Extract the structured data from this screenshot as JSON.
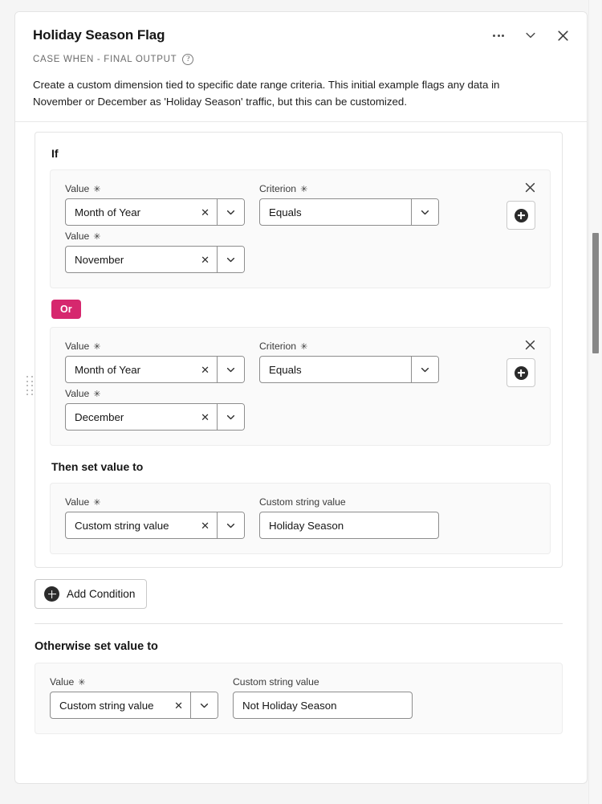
{
  "header": {
    "title": "Holiday Season Flag",
    "subtitle": "CASE WHEN - FINAL OUTPUT",
    "help_icon": "question-mark-circle-icon",
    "description": "Create a custom dimension tied to specific date range criteria. This initial example flags any data in November or December as 'Holiday Season' traffic, but this can be customized.",
    "actions": [
      {
        "name": "more-options",
        "icon": "ellipsis-icon"
      },
      {
        "name": "collapse",
        "icon": "chevron-down-icon"
      },
      {
        "name": "close",
        "icon": "close-icon"
      }
    ]
  },
  "labels": {
    "if": "If",
    "or": "Or",
    "then_set_value_to": "Then set value to",
    "otherwise_set_value_to": "Otherwise set value to",
    "add_condition": "Add Condition",
    "value": "Value",
    "criterion": "Criterion",
    "custom_string_value": "Custom string value",
    "required_star": "✳",
    "clear_x": "✕"
  },
  "conditions": [
    {
      "value_field": {
        "label": "Value",
        "value": "Month of Year",
        "required": true
      },
      "criterion_field": {
        "label": "Criterion",
        "value": "Equals",
        "required": true
      },
      "value2_field": {
        "label": "Value",
        "value": "November",
        "required": true
      }
    },
    {
      "value_field": {
        "label": "Value",
        "value": "Month of Year",
        "required": true
      },
      "criterion_field": {
        "label": "Criterion",
        "value": "Equals",
        "required": true
      },
      "value2_field": {
        "label": "Value",
        "value": "December",
        "required": true
      }
    }
  ],
  "then_block": {
    "value_field": {
      "label": "Value",
      "value": "Custom string value",
      "required": true
    },
    "string_field": {
      "label": "Custom string value",
      "value": "Holiday Season"
    }
  },
  "otherwise_block": {
    "value_field": {
      "label": "Value",
      "value": "Custom string value",
      "required": true
    },
    "string_field": {
      "label": "Custom string value",
      "value": "Not Holiday Season"
    }
  },
  "colors": {
    "accent_badge": "#d6286e",
    "page_background": "#f5f5f5",
    "card_background": "#ffffff",
    "panel_background": "#fafafa",
    "text_primary": "#161616",
    "text_secondary": "#6b6b6b",
    "border": "#8d8d8d"
  }
}
